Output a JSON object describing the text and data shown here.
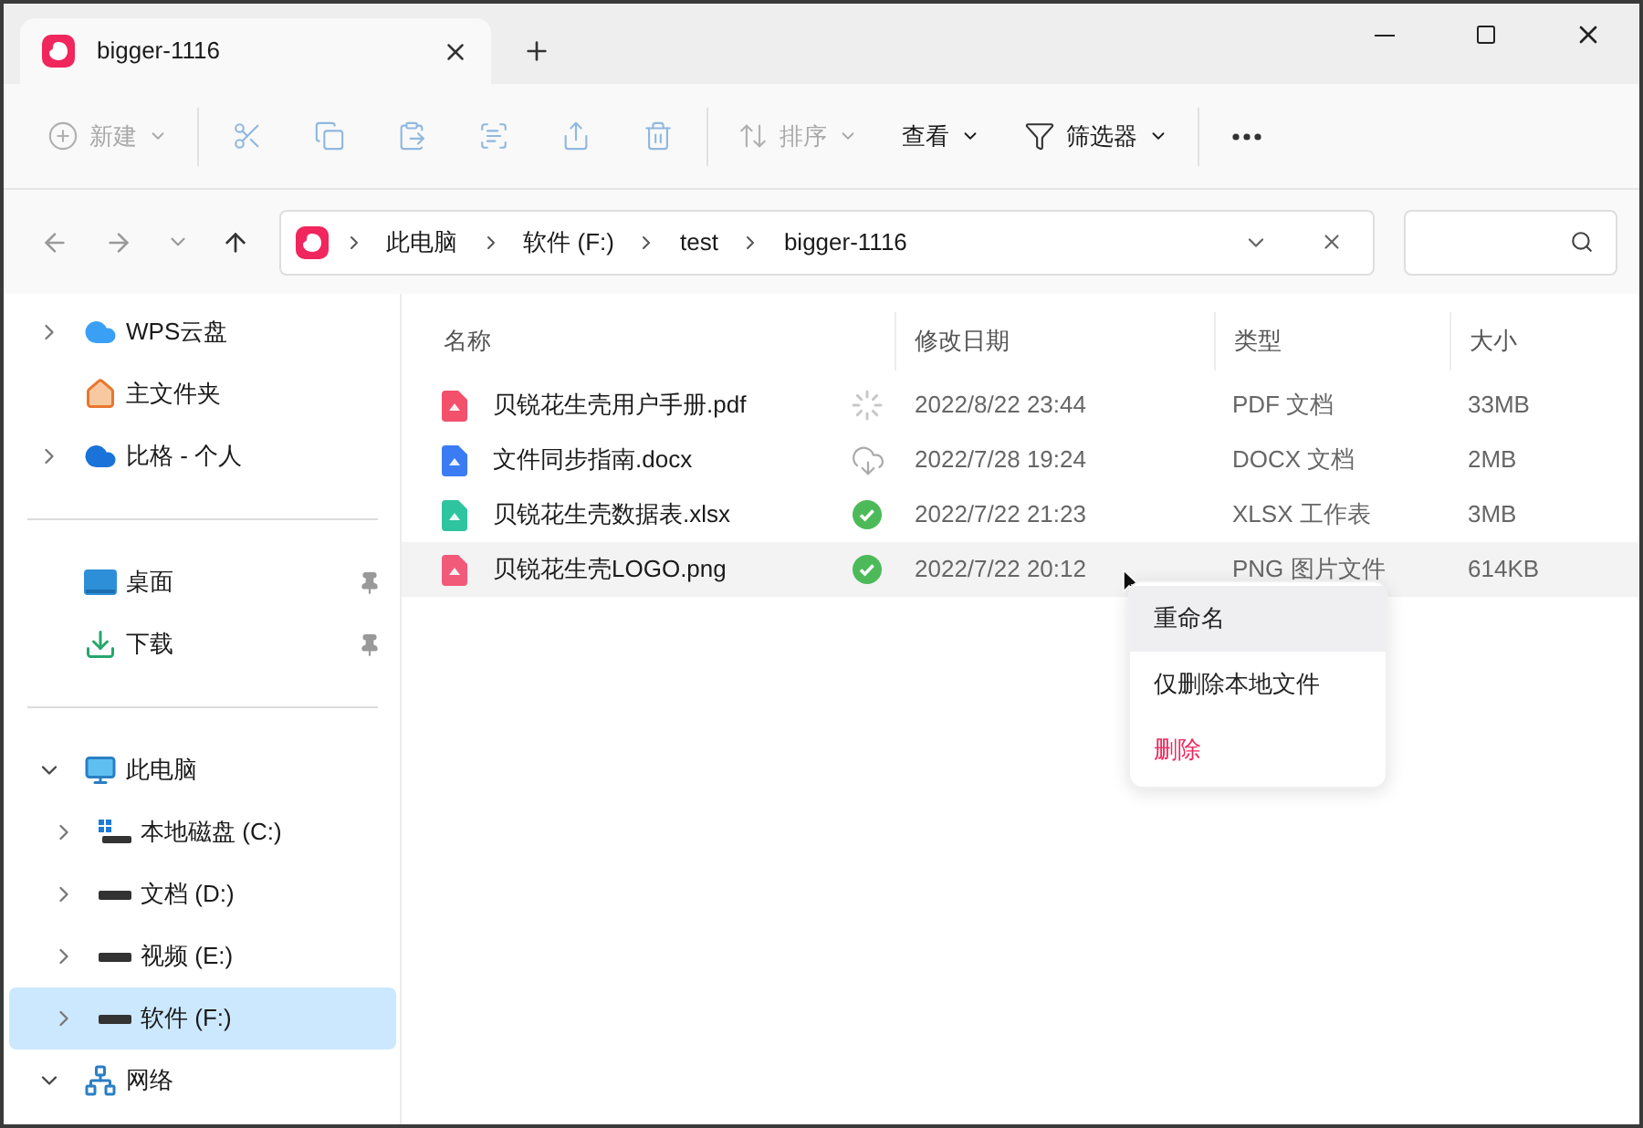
{
  "window": {
    "tabs": [
      {
        "title": "bigger-1116",
        "selected": true
      }
    ]
  },
  "toolbar": [
    {
      "kind": "new",
      "label": "新建",
      "disabled": true
    },
    {
      "kind": "cut",
      "disabled": true
    },
    {
      "kind": "copy",
      "disabled": true
    },
    {
      "kind": "paste",
      "disabled": true
    },
    {
      "kind": "rename",
      "disabled": true
    },
    {
      "kind": "share",
      "disabled": true
    },
    {
      "kind": "delete",
      "disabled": true
    },
    {
      "kind": "sort",
      "label": "排序",
      "disabled": true
    },
    {
      "kind": "view",
      "label": "查看",
      "disabled": false
    },
    {
      "kind": "filter",
      "label": "筛选器",
      "disabled": false
    },
    {
      "kind": "more",
      "disabled": false
    }
  ],
  "address_bar": {
    "breadcrumb": [
      "此电脑",
      "软件 (F:)",
      "test",
      "bigger-1116"
    ]
  },
  "sidebar": {
    "groups": [
      {
        "items": [
          {
            "label": "WPS云盘",
            "kind": "cloud",
            "expanded": false,
            "selected": false
          },
          {
            "label": "主文件夹",
            "kind": "home",
            "selected": false
          },
          {
            "label": "比格 - 个人",
            "kind": "onedrive",
            "expanded": false,
            "selected": false
          }
        ]
      },
      {
        "items": [
          {
            "label": "桌面",
            "kind": "desktop",
            "pinned": true,
            "selected": false
          },
          {
            "label": "下载",
            "kind": "download",
            "pinned": true,
            "selected": false
          }
        ]
      },
      {
        "items": [
          {
            "label": "此电脑",
            "kind": "pc",
            "expanded": true,
            "selected": false,
            "children": [
              {
                "label": "本地磁盘 (C:)",
                "kind": "system_drive",
                "expanded": false,
                "selected": false
              },
              {
                "label": "文档 (D:)",
                "kind": "drive",
                "expanded": false,
                "selected": false
              },
              {
                "label": "视频 (E:)",
                "kind": "drive",
                "expanded": false,
                "selected": false
              },
              {
                "label": "软件 (F:)",
                "kind": "drive",
                "expanded": false,
                "selected": true
              }
            ]
          },
          {
            "label": "网络",
            "kind": "network",
            "expanded": true,
            "selected": false
          }
        ]
      }
    ]
  },
  "file_list": {
    "columns": [
      "名称",
      "修改日期",
      "类型",
      "大小"
    ],
    "rows": [
      {
        "name": "贝锐花生壳用户手册.pdf",
        "kind": "pdf",
        "sync_status": {
          "kind": "syncing"
        },
        "modified": "2022/8/22 23:44",
        "type": "PDF 文档",
        "size": "33MB",
        "selected": false
      },
      {
        "name": "文件同步指南.docx",
        "kind": "docx",
        "sync_status": {
          "kind": "cloud"
        },
        "modified": "2022/7/28 19:24",
        "type": "DOCX 文档",
        "size": "2MB",
        "selected": false
      },
      {
        "name": "贝锐花生壳数据表.xlsx",
        "kind": "xlsx",
        "sync_status": {
          "kind": "done"
        },
        "modified": "2022/7/22 21:23",
        "type": "XLSX 工作表",
        "size": "3MB",
        "selected": false
      },
      {
        "name": "贝锐花生壳LOGO.png",
        "kind": "png",
        "sync_status": {
          "kind": "done"
        },
        "modified": "2022/7/22 20:12",
        "type": "PNG 图片文件",
        "size": "614KB",
        "selected": true
      }
    ]
  },
  "context_menu": {
    "items": [
      {
        "label": "重命名",
        "kind": "normal",
        "selected": true
      },
      {
        "label": "仅删除本地文件",
        "kind": "normal",
        "selected": false
      },
      {
        "label": "删除",
        "kind": "danger",
        "selected": false
      }
    ]
  }
}
